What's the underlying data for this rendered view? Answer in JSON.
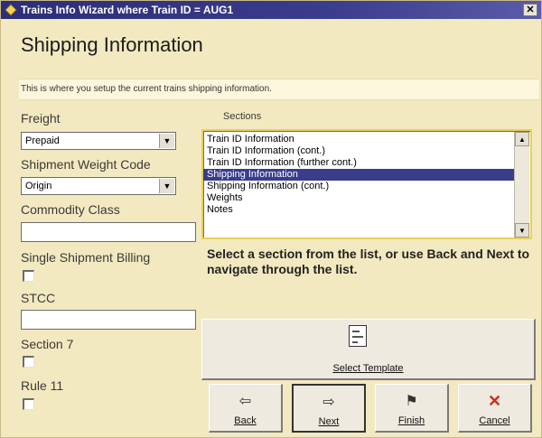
{
  "window": {
    "title": "Trains Info Wizard where Train ID = AUG1",
    "close_glyph": "✕"
  },
  "page": {
    "title": "Shipping Information",
    "description": "This is where you setup the current trains shipping information."
  },
  "form": {
    "freight": {
      "label": "Freight",
      "value": "Prepaid"
    },
    "shipment_weight_code": {
      "label": "Shipment Weight Code",
      "value": "Origin"
    },
    "commodity_class": {
      "label": "Commodity Class",
      "value": ""
    },
    "single_shipment_billing": {
      "label": "Single Shipment Billing",
      "checked": false
    },
    "stcc": {
      "label": "STCC",
      "value": ""
    },
    "section7": {
      "label": "Section 7",
      "checked": false
    },
    "rule11": {
      "label": "Rule 11",
      "checked": false
    }
  },
  "sections": {
    "label": "Sections",
    "items": [
      "Train ID Information",
      "Train ID Information (cont.)",
      "Train ID Information (further cont.)",
      "Shipping Information",
      "Shipping Information (cont.)",
      "Weights",
      "Notes"
    ],
    "selected_index": 3
  },
  "instruction": "Select a section from the list, or use Back and Next to navigate through the list.",
  "buttons": {
    "select_template": "Select Template",
    "back": "Back",
    "next": "Next",
    "finish": "Finish",
    "cancel": "Cancel"
  },
  "icons": {
    "back": "⇦",
    "next": "⇨",
    "finish": "⚑",
    "cancel": "✕",
    "dropdown": "▼",
    "scroll_up": "▲",
    "scroll_down": "▼"
  }
}
